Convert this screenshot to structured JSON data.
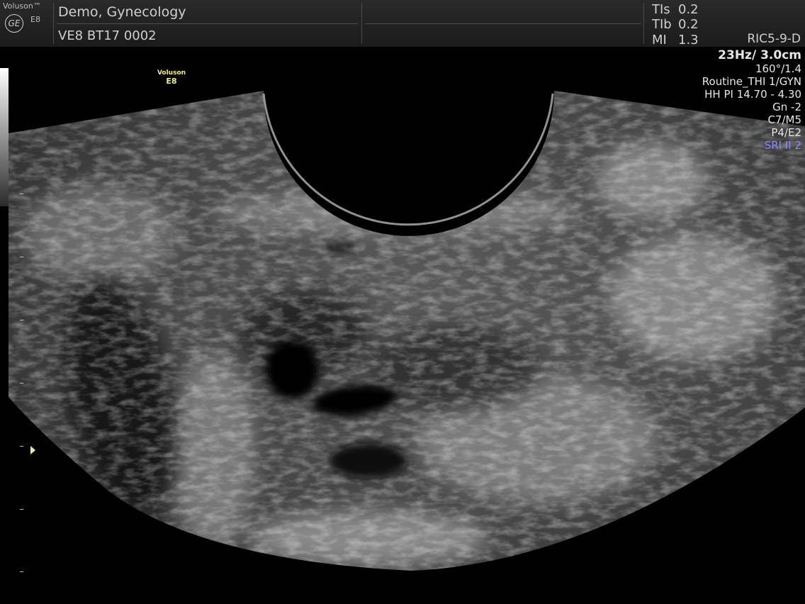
{
  "header": {
    "brand_text": "Voluson™",
    "ge_logo_text": "GE",
    "model_small": "E8",
    "patient_name": "Demo, Gynecology",
    "exam_id": "VE8 BT17 0002",
    "safety": [
      {
        "label": "TIs",
        "value": "0.2"
      },
      {
        "label": "TIb",
        "value": "0.2"
      },
      {
        "label": "MI",
        "value": "1.3"
      }
    ],
    "probe": "RIC5-9-D"
  },
  "params": {
    "frame_rate_depth": "23Hz/ 3.0cm",
    "angle": "160°/1.4",
    "preset": "Routine_THI 1/GYN",
    "harmonics": "HH PI 14.70 - 4.30",
    "gain": "Gn  -2",
    "map": "C7/M5",
    "power": "P4/E2",
    "sri": "SRI II 2"
  },
  "image_watermark": {
    "line1": "Voluson",
    "line2": "E8"
  },
  "icons": {
    "focus_marker": "focus-marker-arrow-icon",
    "logo": "ge-logo-icon"
  },
  "colors": {
    "background": "#000000",
    "header": "#222222",
    "sri_text": "#8a8aff",
    "watermark": "#f2f088",
    "focus_marker": "#f3e9a6"
  }
}
